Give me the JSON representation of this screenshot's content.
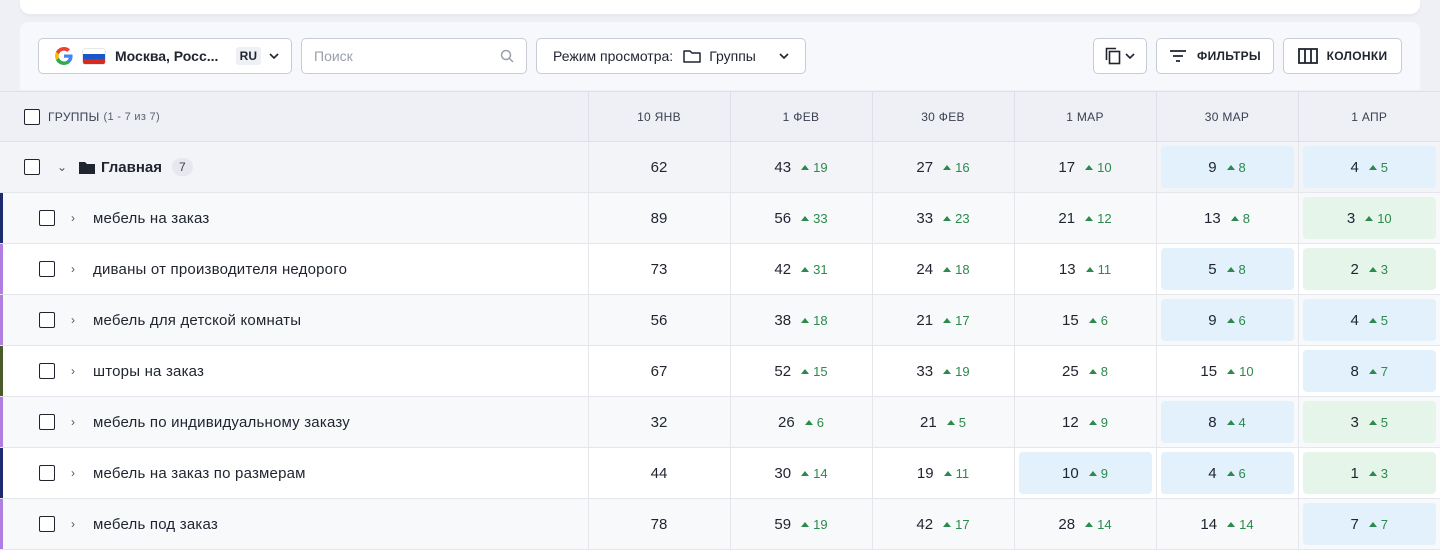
{
  "toolbar": {
    "region": {
      "city": "Москва, Росс...",
      "lang": "RU"
    },
    "search": {
      "placeholder": "Поиск"
    },
    "view": {
      "label": "Режим просмотра:",
      "value": "Группы"
    },
    "filters_label": "ФИЛЬТРЫ",
    "columns_label": "КОЛОНКИ"
  },
  "table": {
    "group_header": "ГРУППЫ",
    "group_count": "(1 - 7 из 7)",
    "dates": [
      "10 ЯНВ",
      "1 ФЕВ",
      "30 ФЕВ",
      "1 МАР",
      "30 МАР",
      "1 АПР"
    ],
    "main": {
      "title": "Главная",
      "count": "7",
      "cells": [
        {
          "v": "62",
          "d": "",
          "hl": ""
        },
        {
          "v": "43",
          "d": "19",
          "hl": ""
        },
        {
          "v": "27",
          "d": "16",
          "hl": ""
        },
        {
          "v": "17",
          "d": "10",
          "hl": ""
        },
        {
          "v": "9",
          "d": "8",
          "hl": "blue"
        },
        {
          "v": "4",
          "d": "5",
          "hl": "blue"
        }
      ]
    },
    "rows": [
      {
        "keyword": "мебель на заказ",
        "bar": "#1e2a6e",
        "cells": [
          {
            "v": "89",
            "d": "",
            "hl": ""
          },
          {
            "v": "56",
            "d": "33",
            "hl": ""
          },
          {
            "v": "33",
            "d": "23",
            "hl": ""
          },
          {
            "v": "21",
            "d": "12",
            "hl": ""
          },
          {
            "v": "13",
            "d": "8",
            "hl": ""
          },
          {
            "v": "3",
            "d": "10",
            "hl": "green"
          }
        ]
      },
      {
        "keyword": "диваны от производителя недорого",
        "bar": "#b07ee0",
        "cells": [
          {
            "v": "73",
            "d": "",
            "hl": ""
          },
          {
            "v": "42",
            "d": "31",
            "hl": ""
          },
          {
            "v": "24",
            "d": "18",
            "hl": ""
          },
          {
            "v": "13",
            "d": "11",
            "hl": ""
          },
          {
            "v": "5",
            "d": "8",
            "hl": "blue"
          },
          {
            "v": "2",
            "d": "3",
            "hl": "green"
          }
        ]
      },
      {
        "keyword": "мебель для детской комнаты",
        "bar": "#b07ee0",
        "cells": [
          {
            "v": "56",
            "d": "",
            "hl": ""
          },
          {
            "v": "38",
            "d": "18",
            "hl": ""
          },
          {
            "v": "21",
            "d": "17",
            "hl": ""
          },
          {
            "v": "15",
            "d": "6",
            "hl": ""
          },
          {
            "v": "9",
            "d": "6",
            "hl": "blue"
          },
          {
            "v": "4",
            "d": "5",
            "hl": "blue"
          }
        ]
      },
      {
        "keyword": "шторы на заказ",
        "bar": "#4a5a2a",
        "cells": [
          {
            "v": "67",
            "d": "",
            "hl": ""
          },
          {
            "v": "52",
            "d": "15",
            "hl": ""
          },
          {
            "v": "33",
            "d": "19",
            "hl": ""
          },
          {
            "v": "25",
            "d": "8",
            "hl": ""
          },
          {
            "v": "15",
            "d": "10",
            "hl": ""
          },
          {
            "v": "8",
            "d": "7",
            "hl": "blue"
          }
        ]
      },
      {
        "keyword": "мебель по индивидуальному заказу",
        "bar": "#b07ee0",
        "cells": [
          {
            "v": "32",
            "d": "",
            "hl": ""
          },
          {
            "v": "26",
            "d": "6",
            "hl": ""
          },
          {
            "v": "21",
            "d": "5",
            "hl": ""
          },
          {
            "v": "12",
            "d": "9",
            "hl": ""
          },
          {
            "v": "8",
            "d": "4",
            "hl": "blue"
          },
          {
            "v": "3",
            "d": "5",
            "hl": "green"
          }
        ]
      },
      {
        "keyword": "мебель на заказ по размерам",
        "bar": "#1e2a6e",
        "cells": [
          {
            "v": "44",
            "d": "",
            "hl": ""
          },
          {
            "v": "30",
            "d": "14",
            "hl": ""
          },
          {
            "v": "19",
            "d": "11",
            "hl": ""
          },
          {
            "v": "10",
            "d": "9",
            "hl": "blue"
          },
          {
            "v": "4",
            "d": "6",
            "hl": "blue"
          },
          {
            "v": "1",
            "d": "3",
            "hl": "green"
          }
        ]
      },
      {
        "keyword": "мебель под заказ",
        "bar": "#b07ee0",
        "cells": [
          {
            "v": "78",
            "d": "",
            "hl": ""
          },
          {
            "v": "59",
            "d": "19",
            "hl": ""
          },
          {
            "v": "42",
            "d": "17",
            "hl": ""
          },
          {
            "v": "28",
            "d": "14",
            "hl": ""
          },
          {
            "v": "14",
            "d": "14",
            "hl": ""
          },
          {
            "v": "7",
            "d": "7",
            "hl": "blue"
          }
        ]
      }
    ]
  }
}
